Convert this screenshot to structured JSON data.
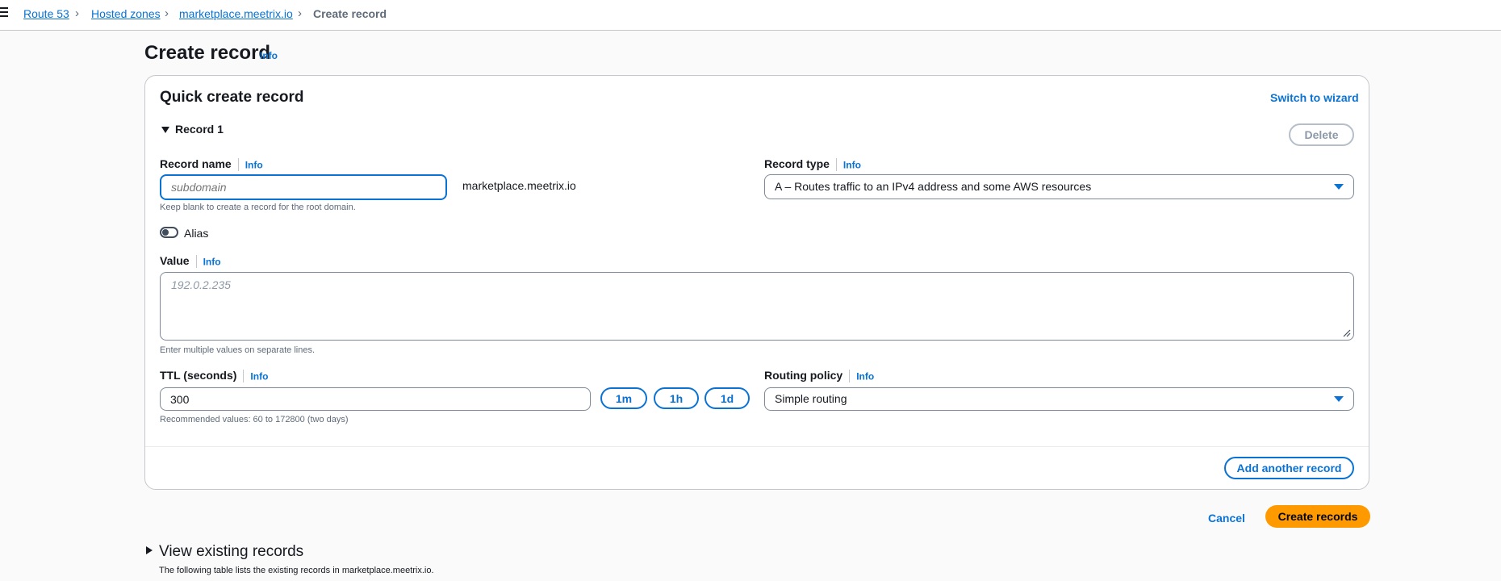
{
  "breadcrumb": {
    "items": [
      "Route 53",
      "Hosted zones",
      "marketplace.meetrix.io"
    ],
    "current": "Create record"
  },
  "page": {
    "title": "Create record",
    "info": "Info"
  },
  "card": {
    "title": "Quick create record",
    "switch_label": "Switch to wizard",
    "record_toggle_label": "Record 1",
    "delete_label": "Delete",
    "record_name": {
      "label": "Record name",
      "info": "Info",
      "placeholder": "subdomain",
      "value": "",
      "suffix": "marketplace.meetrix.io",
      "hint": "Keep blank to create a record for the root domain."
    },
    "record_type": {
      "label": "Record type",
      "info": "Info",
      "selected": "A – Routes traffic to an IPv4 address and some AWS resources"
    },
    "alias": {
      "label": "Alias",
      "enabled": false
    },
    "value": {
      "label": "Value",
      "info": "Info",
      "placeholder": "192.0.2.235",
      "hint": "Enter multiple values on separate lines."
    },
    "ttl": {
      "label": "TTL (seconds)",
      "info": "Info",
      "value": "300",
      "presets": [
        "1m",
        "1h",
        "1d"
      ],
      "hint": "Recommended values: 60 to 172800 (two days)"
    },
    "routing_policy": {
      "label": "Routing policy",
      "info": "Info",
      "selected": "Simple routing"
    },
    "add_another_label": "Add another record"
  },
  "actions": {
    "cancel_label": "Cancel",
    "create_label": "Create records"
  },
  "existing": {
    "title": "View existing records",
    "description": "The following table lists the existing records in marketplace.meetrix.io."
  },
  "colors": {
    "link": "#0972d3",
    "primary_button": "#ff9900",
    "border": "#c6c6cd",
    "text": "#16191f"
  }
}
